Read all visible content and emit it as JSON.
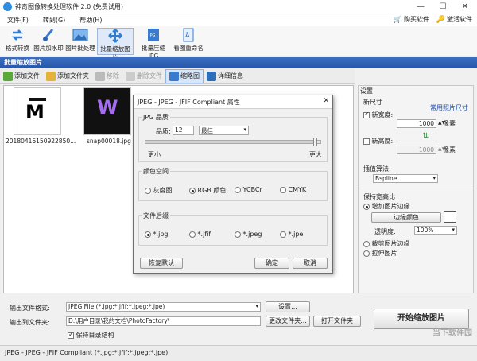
{
  "window": {
    "title": "神奇图像转换处理软件 2.0 (免费试用)",
    "min": "—",
    "max": "☐",
    "close": "✕"
  },
  "menu": {
    "items": [
      "文件(F)",
      "转到(G)",
      "帮助(H)"
    ],
    "buy": "购买软件",
    "activate": "激活软件"
  },
  "toolbar": {
    "items": [
      "格式转换",
      "图片加水印",
      "图片批处理",
      "批量缩放图片",
      "批量压缩JPG",
      "看图重命名"
    ]
  },
  "section": {
    "title": "批量缩放图片"
  },
  "filebar": {
    "add_file": "添加文件",
    "add_folder": "添加文件夹",
    "remove": "移除",
    "delete_file": "删除文件",
    "thumbnail": "缩略图",
    "details": "详细信息"
  },
  "files": [
    {
      "name": "20180416150922850...",
      "glyph": "M"
    },
    {
      "name": "snap00018.jpg",
      "glyph": "W"
    }
  ],
  "settings": {
    "title": "设置",
    "new_size": "新尺寸",
    "common_sizes": "常用照片尺寸",
    "new_width_label": "新宽度:",
    "new_width_value": "1000",
    "width_unit": "像素",
    "new_height_label": "新高度:",
    "new_height_value": "1000",
    "height_unit": "像素",
    "interp_label": "插值算法:",
    "interp_value": "Bspline",
    "keep_ratio": "保持宽高比",
    "add_border": "增加图片边缘",
    "border_color": "边缘颜色",
    "opacity_label": "透明度:",
    "opacity_value": "100%",
    "crop_edges": "裁剪图片边缘",
    "stretch": "拉伸图片"
  },
  "bottom": {
    "format_label": "输出文件格式:",
    "format_value": "JPEG File (*.jpg;*.jfif;*.jpeg;*.jpe)",
    "settings_btn": "设置...",
    "folder_label": "输出到文件夹:",
    "folder_value": "D:\\用户目录\\我的文档\\PhotoFactory\\",
    "change_folder": "更改文件夹...",
    "open_folder": "打开文件夹",
    "keep_structure": "保持目录结构",
    "start": "开始缩放图片"
  },
  "status": {
    "text": "JPEG - JPEG - JFIF Compliant (*.jpg;*.jfif;*.jpeg;*.jpe)"
  },
  "dialog": {
    "title": "JPEG - JPEG - JFIF Compliant 属性",
    "quality_group": "JPG 品质",
    "quality_label": "品质:",
    "quality_value": "12",
    "quality_preset": "最佳",
    "quality_level": 0.98,
    "smaller": "更小",
    "larger": "更大",
    "color_group": "颜色空间",
    "color_options": [
      "灰度图",
      "RGB 颜色",
      "YCBCr",
      "CMYK"
    ],
    "ext_group": "文件后缀",
    "ext_options": [
      "*.jpg",
      "*.jfif",
      "*.jpeg",
      "*.jpe"
    ],
    "restore": "恢复默认",
    "ok": "确定",
    "cancel": "取消"
  },
  "watermark": "当下软件园",
  "colors": {
    "accent": "#2857a8",
    "header": "#3a6fc4",
    "start_bg": "#f7f7f7"
  }
}
